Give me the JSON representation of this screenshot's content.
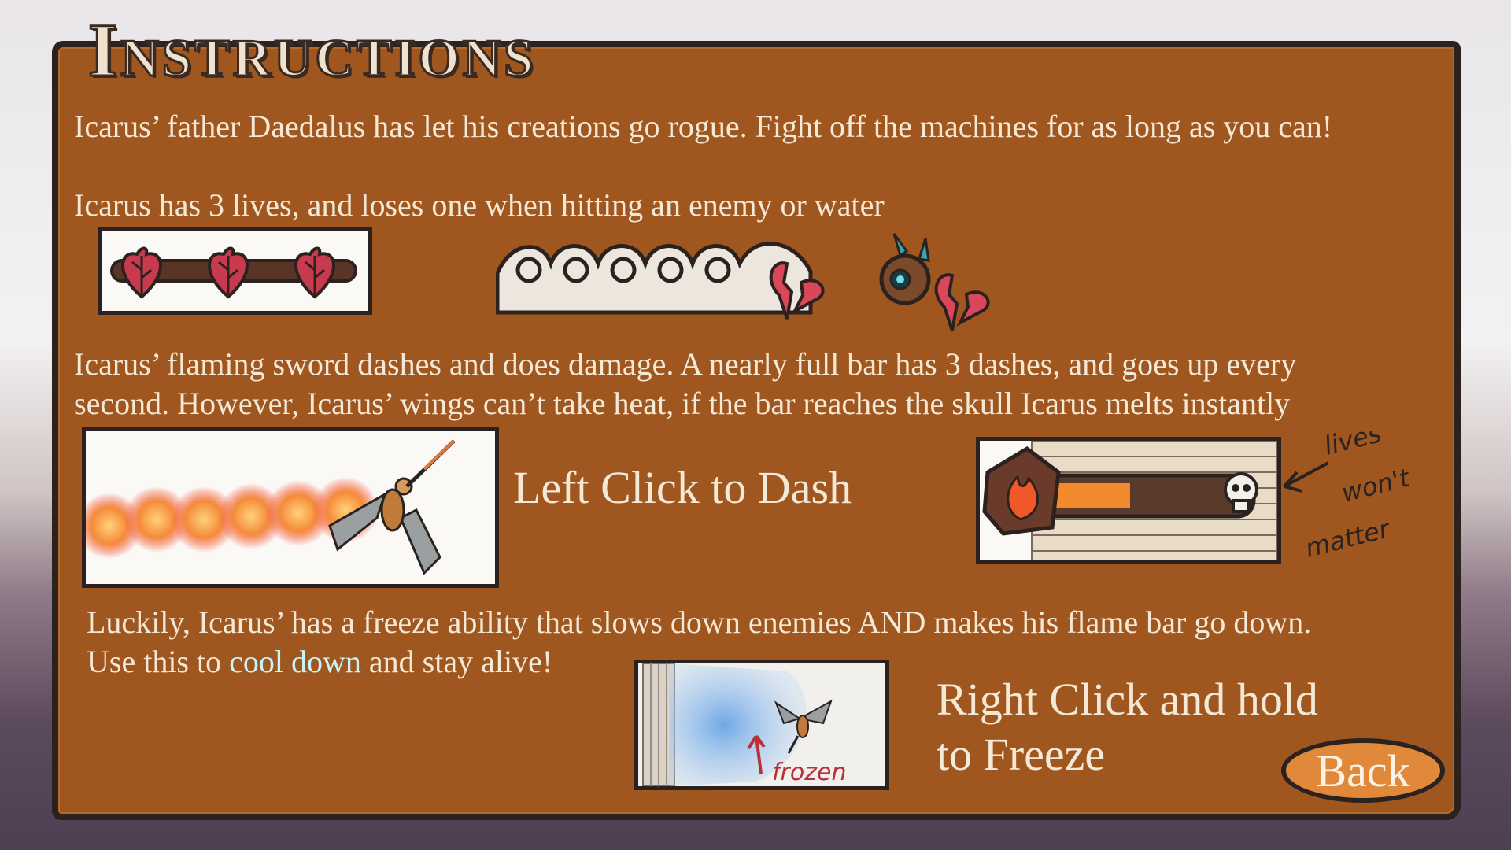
{
  "title": "Instructions",
  "lines": {
    "intro": "Icarus’ father Daedalus has let his creations go rogue. Fight off the machines for as long as you can!",
    "lives": "Icarus has 3 lives, and loses one when hitting an enemy or water",
    "dash_1": "Icarus’ flaming sword dashes and does damage. A nearly full bar has 3 dashes, and goes up every",
    "dash_2": "second. However, Icarus’ wings can’t take heat, if the bar reaches the skull Icarus melts instantly",
    "freeze_1": "Luckily, Icarus’ has a freeze ability that slows down enemies AND makes his flame bar go down.",
    "freeze_2a": "Use this to ",
    "freeze_2b": "cool down",
    "freeze_2c": " and stay alive!"
  },
  "controls": {
    "dash": "Left Click to Dash",
    "freeze_1": "Right Click and hold",
    "freeze_2": "to Freeze"
  },
  "annotations": {
    "lives_note": [
      "lives",
      "won't",
      "matter"
    ],
    "frozen_note": "frozen"
  },
  "buttons": {
    "back": "Back"
  },
  "colors": {
    "panel": "#a0561f",
    "text": "#f4e8d6",
    "cool_text": "#c8f4f8",
    "back_button": "#e0893a",
    "heart": "#d8485a",
    "flame_bar": "#f08a2c"
  },
  "flame_bar_level": 0.45,
  "lives_count": 3
}
